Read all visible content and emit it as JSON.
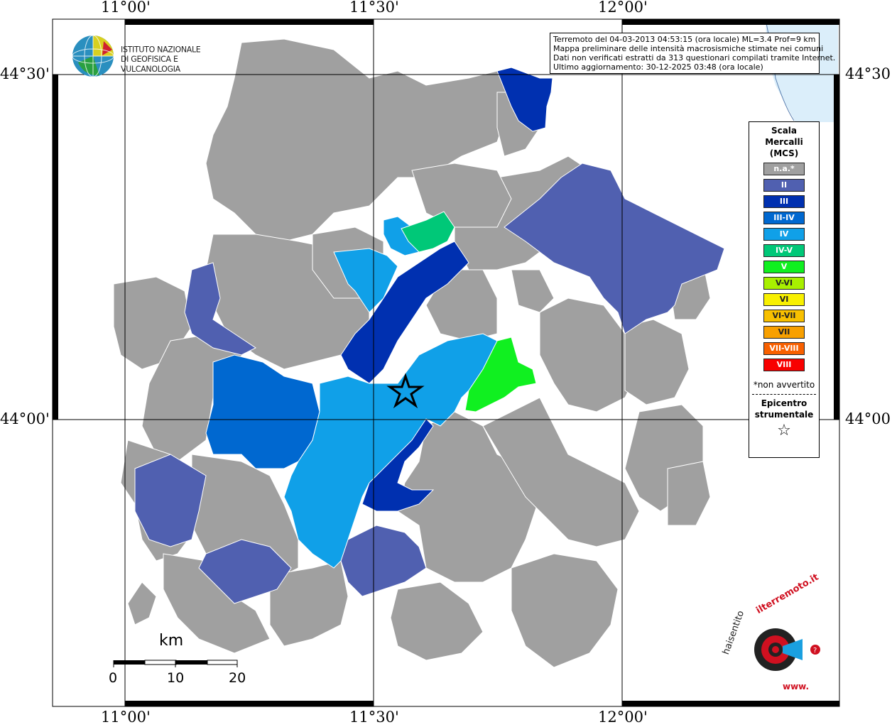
{
  "coords": {
    "top": [
      "11°00'",
      "11°30'",
      "12°00'"
    ],
    "bottom": [
      "11°00'",
      "11°30'",
      "12°00'"
    ],
    "left": [
      "44°30'",
      "44°00'"
    ],
    "right": [
      "44°30'",
      "44°00'"
    ]
  },
  "institute": {
    "line1": "ISTITUTO NAZIONALE",
    "line2": "DI GEOFISICA E VULCANOLOGIA"
  },
  "info": {
    "line1": "Terremoto del 04-03-2013 04:53:15 (ora locale) ML=3.4 Prof=9 km",
    "line2": "Mappa preliminare delle intensità macrosismiche stimate nei comuni",
    "line3": "Dati non verificati estratti da 313 questionari compilati tramite Internet.",
    "line4": "Ultimo aggiornamento: 30-12-2025 03:48 (ora locale)"
  },
  "legend": {
    "title_line1": "Scala",
    "title_line2": "Mercalli",
    "title_line3": "(MCS)",
    "items": [
      {
        "label": "n.a.*",
        "color": "#a0a0a0"
      },
      {
        "label": "II",
        "color": "#5060b0"
      },
      {
        "label": "III",
        "color": "#0030b0"
      },
      {
        "label": "III-IV",
        "color": "#0068d0"
      },
      {
        "label": "IV",
        "color": "#10a0e8"
      },
      {
        "label": "IV-V",
        "color": "#00c878"
      },
      {
        "label": "V",
        "color": "#10f020"
      },
      {
        "label": "V-VI",
        "color": "#a8f000"
      },
      {
        "label": "VI",
        "color": "#f8f000"
      },
      {
        "label": "VI-VII",
        "color": "#f8c000"
      },
      {
        "label": "VII",
        "color": "#f8a000"
      },
      {
        "label": "VII-VIII",
        "color": "#f86000"
      },
      {
        "label": "VIII",
        "color": "#f80000"
      }
    ],
    "note": "*non avvertito",
    "epi_line1": "Epicentro",
    "epi_line2": "strumentale",
    "star": "☆"
  },
  "scale": {
    "unit": "km",
    "ticks": [
      "0",
      "10",
      "20"
    ]
  },
  "brand": {
    "text_dark": "haisentito",
    "text_accent": "ilterremoto.it",
    "text_url": "www."
  },
  "colors": {
    "na": "#a0a0a0",
    "II": "#5060b0",
    "III": "#0030b0",
    "III-IV": "#0068d0",
    "IV": "#10a0e8",
    "IV-V": "#00c878",
    "V": "#10f020",
    "sea": "#dbeefa"
  }
}
